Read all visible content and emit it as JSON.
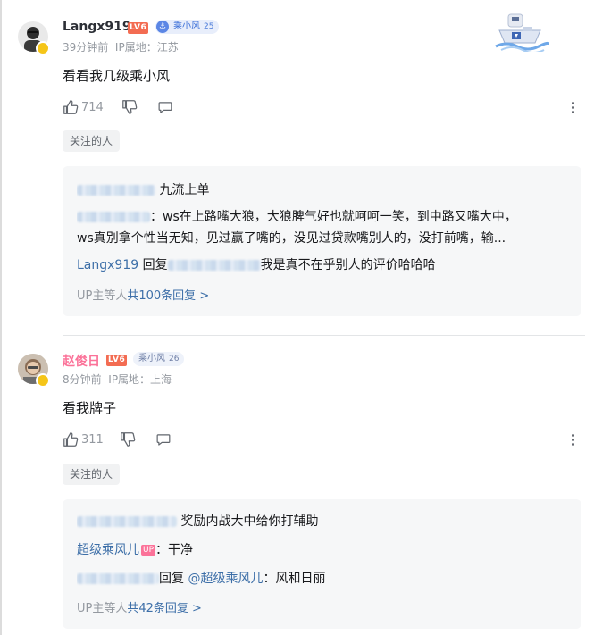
{
  "comments": [
    {
      "username": "Langx919",
      "level": "LV6",
      "fan_badge_name": "乘小风",
      "fan_badge_level": "25",
      "time": "39分钟前",
      "ip": "IP属地：江苏",
      "content": "看看我几级乘小风",
      "likes": "714",
      "tag": "关注的人",
      "replies": [
        {
          "text": "九流上单"
        },
        {
          "text": "：ws在上路嘴大狼，大狼脾气好也就呵呵一笑，到中路又嘴大中，",
          "text2": "ws真别拿个性当无知，见过赢了嘴的，没见过贷款嘴别人的，没打前嘴，输..."
        },
        {
          "user": "Langx919",
          "reply_word": "回复",
          "text": "我是真不在乎别人的评价哈哈哈"
        }
      ],
      "more_prefix": "UP主等人",
      "more_link": "共100条回复",
      "more_arrow": ">"
    },
    {
      "username": "赵俊日",
      "level": "LV6",
      "fan_badge_name": "乘小风",
      "fan_badge_level": "26",
      "time": "8分钟前",
      "ip": "IP属地：上海",
      "content": "看我牌子",
      "likes": "311",
      "tag": "关注的人",
      "replies": [
        {
          "text": "奖励内战大中给你打辅助"
        },
        {
          "user": "超级乘风儿",
          "up_badge": "UP",
          "text": "：干净"
        },
        {
          "reply_word": "回复",
          "mention": "@超级乘风儿",
          "text": "：风和日丽"
        }
      ],
      "more_prefix": "UP主等人",
      "more_link": "共42条回复",
      "more_arrow": ">"
    }
  ],
  "colors": {
    "accent_blue": "#3d6fa8",
    "pink_name": "#fb7299",
    "level_badge": "#f36c52",
    "meta_gray": "#9499a0"
  }
}
